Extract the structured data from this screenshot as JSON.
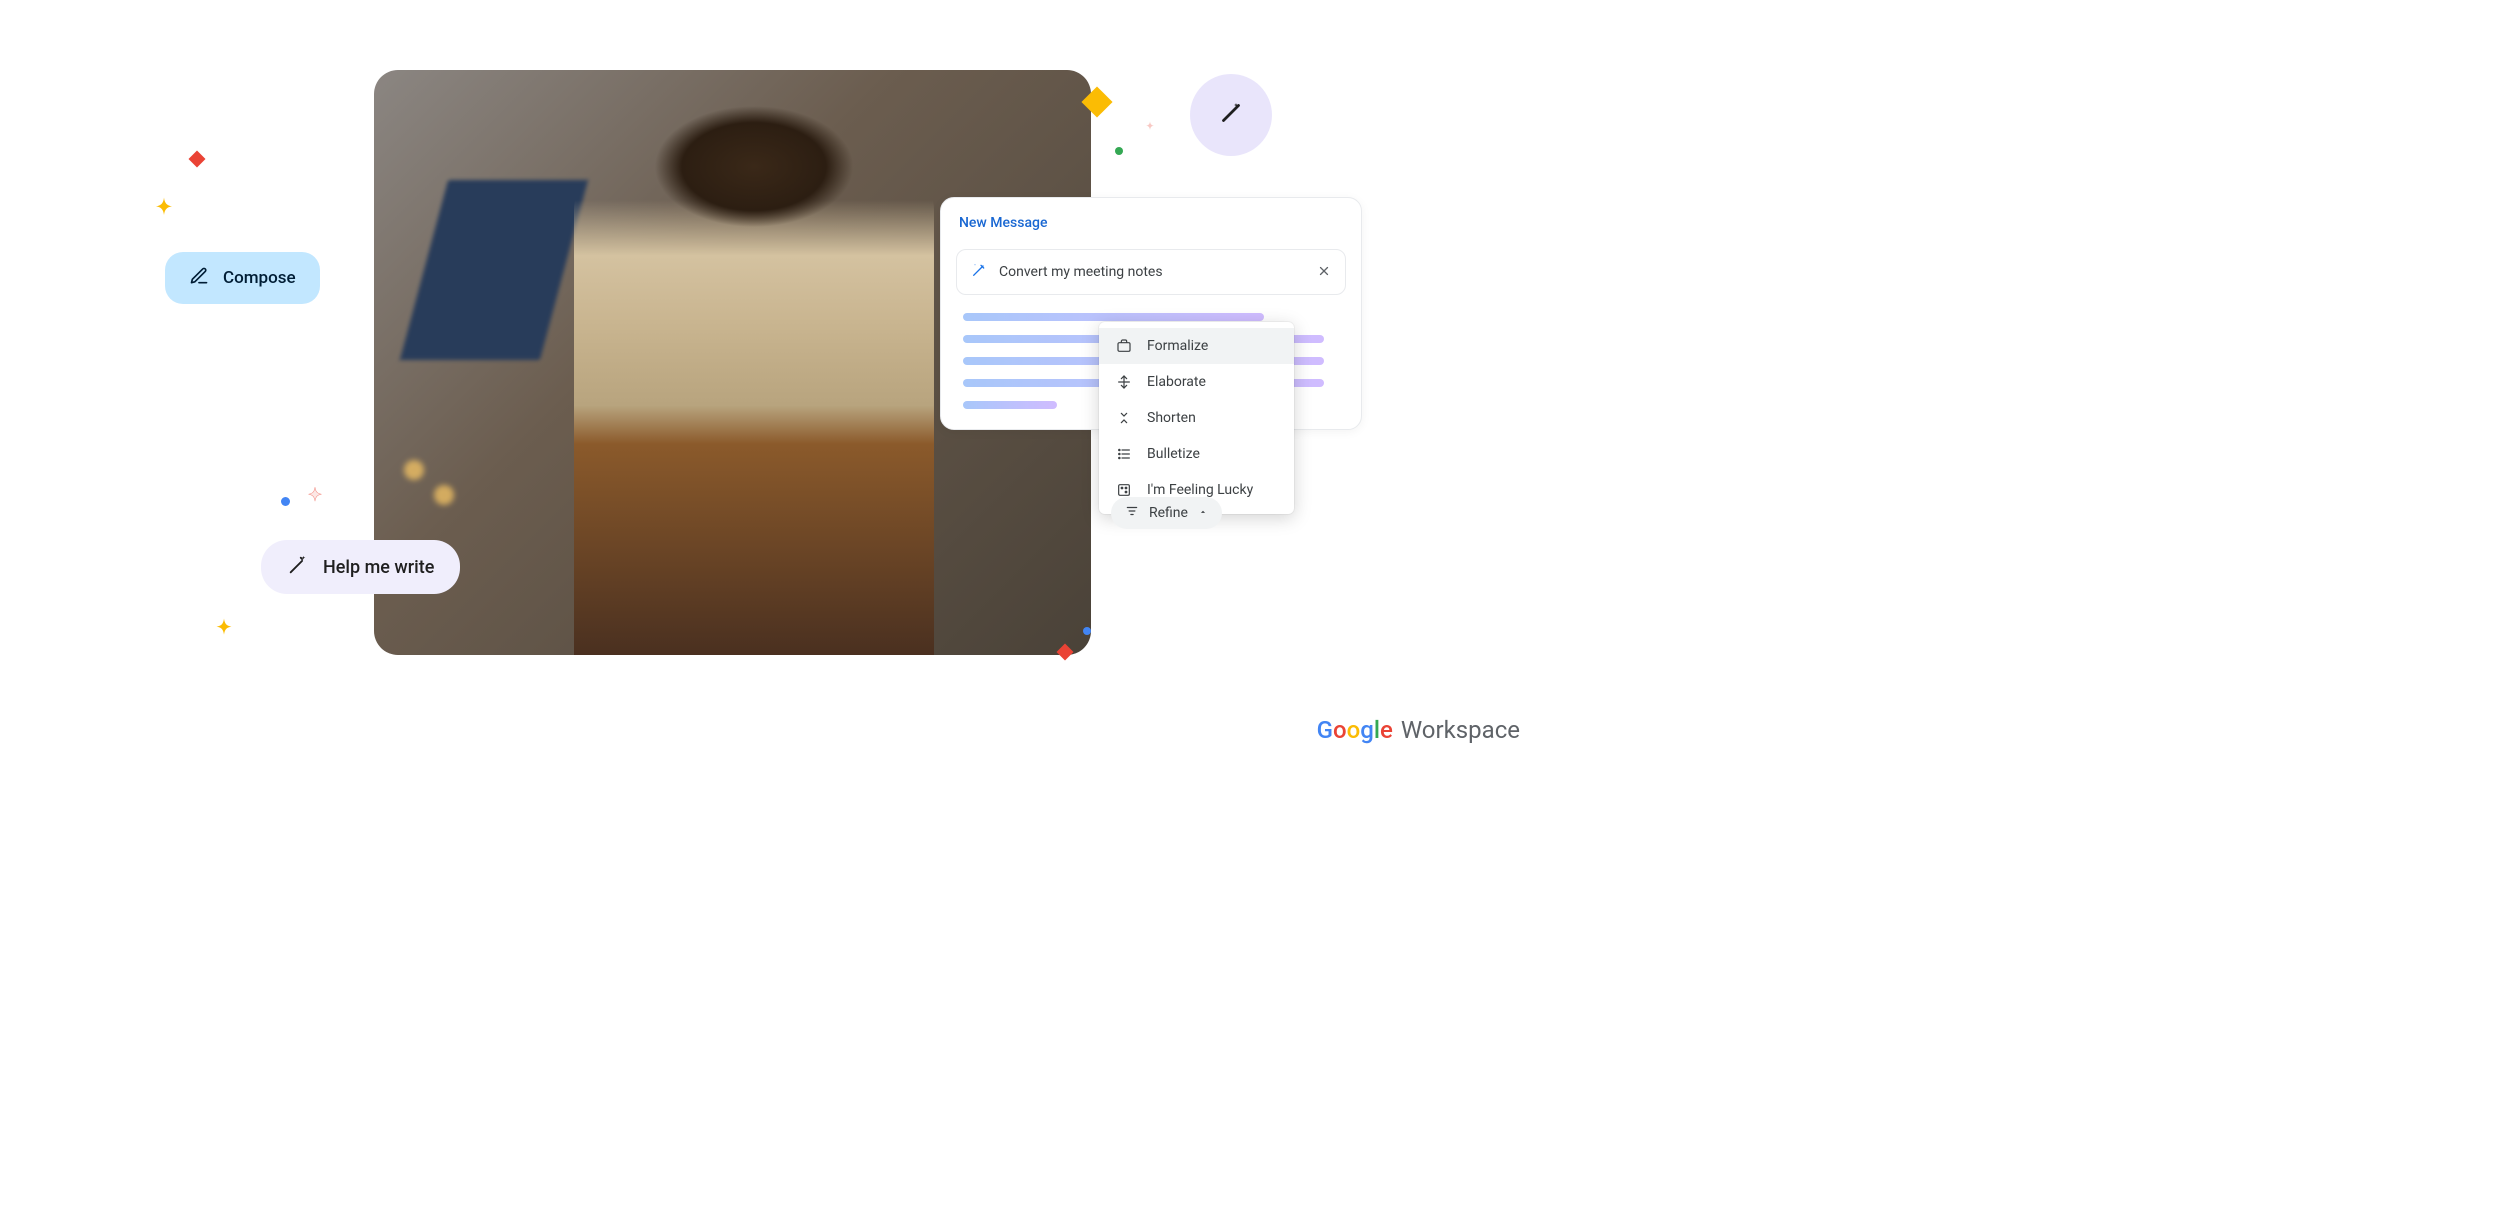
{
  "compose": {
    "label": "Compose"
  },
  "help_write": {
    "label": "Help me write"
  },
  "message_card": {
    "title": "New Message",
    "prompt": "Convert my meeting notes"
  },
  "refine_menu": {
    "items": [
      {
        "label": "Formalize"
      },
      {
        "label": "Elaborate"
      },
      {
        "label": "Shorten"
      },
      {
        "label": "Bulletize"
      },
      {
        "label": "I'm Feeling Lucky"
      }
    ]
  },
  "refine_button": {
    "label": "Refine"
  },
  "logo": {
    "brand": "Google",
    "product": "Workspace"
  }
}
